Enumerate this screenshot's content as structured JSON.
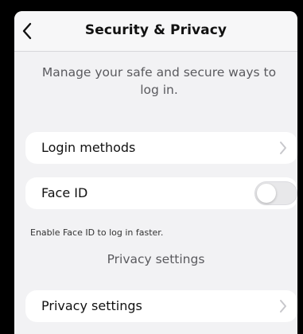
{
  "header": {
    "title": "Security & Privacy",
    "back_icon": "chevron-left-icon"
  },
  "subtitle": "Manage your safe and secure ways to log in.",
  "rows": {
    "login_methods": {
      "label": "Login methods",
      "icon": "chevron-right-icon"
    },
    "face_id": {
      "label": "Face ID",
      "toggle_on": false,
      "helper": "Enable Face ID to log in faster."
    },
    "privacy_settings": {
      "label": "Privacy settings",
      "icon": "chevron-right-icon"
    }
  },
  "privacy_section_title": "Privacy settings",
  "colors": {
    "frame": "#000000",
    "background": "#f2f2f4",
    "card": "#ffffff",
    "muted_text": "#5a5a5e",
    "chevron": "#c8c8cc",
    "toggle_off": "#e8e8ea"
  }
}
